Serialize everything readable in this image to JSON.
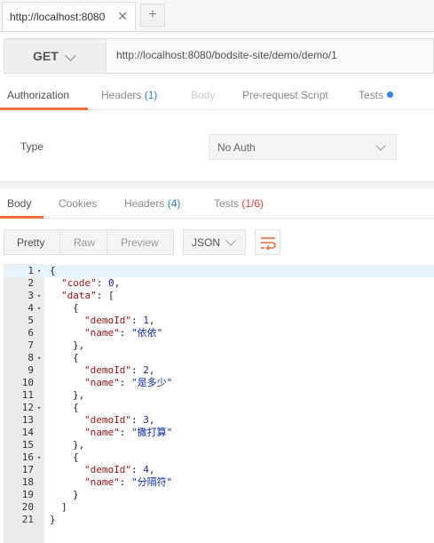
{
  "tab": {
    "title": "http://localhost:8080",
    "close": "✕",
    "add": "+"
  },
  "request": {
    "method": "GET",
    "url": "http://localhost:8080/bodsite-site/demo/demo/1"
  },
  "request_tabs": {
    "authorization": "Authorization",
    "headers": "Headers",
    "headers_count": "(1)",
    "body": "Body",
    "prerequest": "Pre-request Script",
    "tests": "Tests"
  },
  "auth": {
    "type_label": "Type",
    "type_value": "No Auth"
  },
  "response_tabs": {
    "body": "Body",
    "cookies": "Cookies",
    "headers": "Headers",
    "headers_count": "(4)",
    "tests": "Tests",
    "tests_count": "(1/6)"
  },
  "format": {
    "pretty": "Pretty",
    "raw": "Raw",
    "preview": "Preview",
    "language": "JSON"
  },
  "icons": {
    "wrap": "wrap-lines-icon",
    "chevron": "chevron-down-icon",
    "tests_dot": "status-dot",
    "accent": "#f26b3a"
  },
  "code_lines": [
    {
      "n": "1",
      "fold": true,
      "text": "{"
    },
    {
      "n": "2",
      "fold": false,
      "text": "\"code\": 0,"
    },
    {
      "n": "3",
      "fold": true,
      "text": "\"data\": ["
    },
    {
      "n": "4",
      "fold": true,
      "text": "{"
    },
    {
      "n": "5",
      "fold": false,
      "text": "\"demoId\": 1,"
    },
    {
      "n": "6",
      "fold": false,
      "text": "\"name\": \"依依\""
    },
    {
      "n": "7",
      "fold": false,
      "text": "},"
    },
    {
      "n": "8",
      "fold": true,
      "text": "{"
    },
    {
      "n": "9",
      "fold": false,
      "text": "\"demoId\": 2,"
    },
    {
      "n": "10",
      "fold": false,
      "text": "\"name\": \"是多少\""
    },
    {
      "n": "11",
      "fold": false,
      "text": "},"
    },
    {
      "n": "12",
      "fold": true,
      "text": "{"
    },
    {
      "n": "13",
      "fold": false,
      "text": "\"demoId\": 3,"
    },
    {
      "n": "14",
      "fold": false,
      "text": "\"name\": \"撒打算\""
    },
    {
      "n": "15",
      "fold": false,
      "text": "},"
    },
    {
      "n": "16",
      "fold": true,
      "text": "{"
    },
    {
      "n": "17",
      "fold": false,
      "text": "\"demoId\": 4,"
    },
    {
      "n": "18",
      "fold": false,
      "text": "\"name\": \"分隔符\""
    },
    {
      "n": "19",
      "fold": false,
      "text": "}"
    },
    {
      "n": "20",
      "fold": false,
      "text": "]"
    },
    {
      "n": "21",
      "fold": false,
      "text": "}"
    }
  ]
}
